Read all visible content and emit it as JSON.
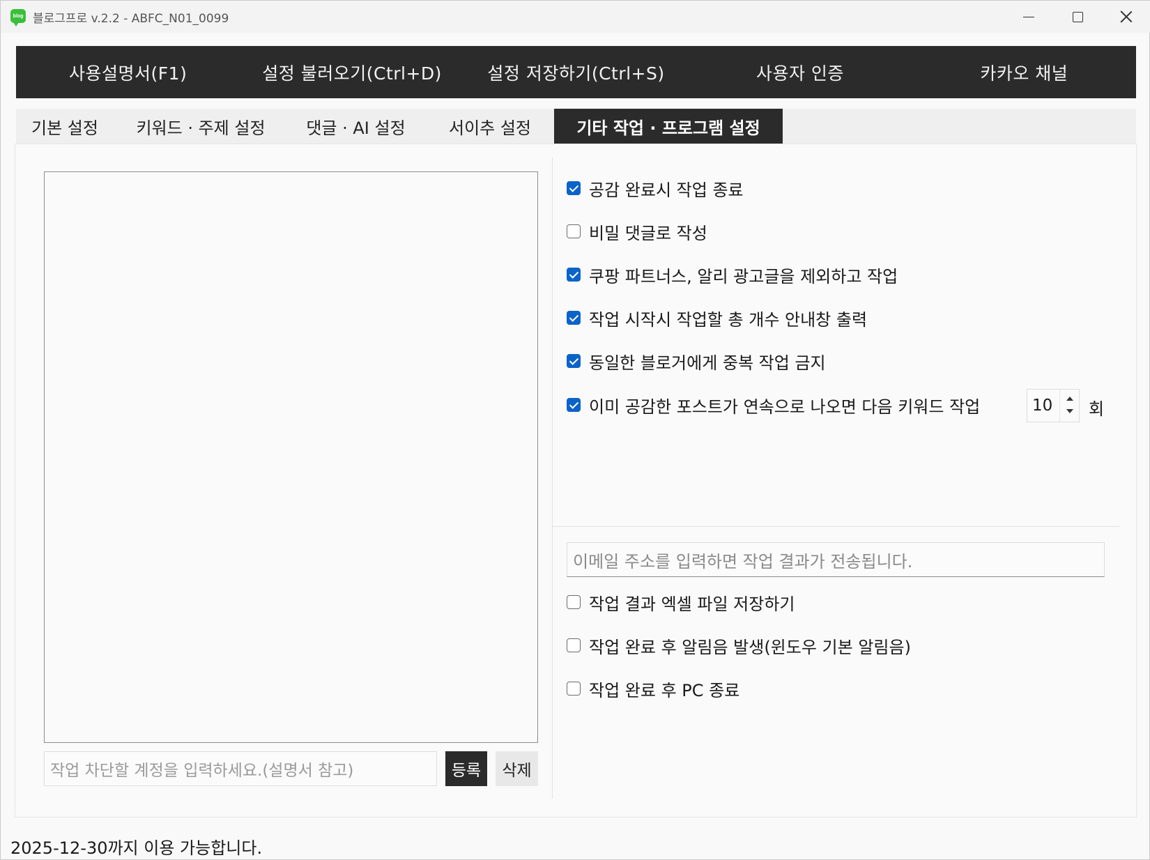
{
  "window": {
    "app_icon_text": "blog",
    "title": "블로그프로 v.2.2 - ABFC_N01_0099"
  },
  "topmenu": [
    {
      "label": "사용설명서(F1)"
    },
    {
      "label": "설정 불러오기(Ctrl+D)"
    },
    {
      "label": "설정 저장하기(Ctrl+S)"
    },
    {
      "label": "사용자 인증"
    },
    {
      "label": "카카오 채널"
    }
  ],
  "tabs": [
    {
      "label": "기본 설정",
      "active": false
    },
    {
      "label": "키워드 · 주제 설정",
      "active": false
    },
    {
      "label": "댓글 · AI 설정",
      "active": false
    },
    {
      "label": "서이추 설정",
      "active": false
    },
    {
      "label": "기타 작업 · 프로그램 설정",
      "active": true
    }
  ],
  "left": {
    "block_input_placeholder": "작업 차단할 계정을 입력하세요.(설명서 참고)",
    "register_label": "등록",
    "delete_label": "삭제"
  },
  "options": [
    {
      "label": "공감 완료시 작업 종료",
      "checked": true
    },
    {
      "label": "비밀 댓글로 작성",
      "checked": false
    },
    {
      "label": "쿠팡 파트너스, 알리 광고글을 제외하고 작업",
      "checked": true
    },
    {
      "label": "작업 시작시 작업할 총 개수 안내창 출력",
      "checked": true
    },
    {
      "label": "동일한 블로거에게 중복 작업 금지",
      "checked": true
    },
    {
      "label": "이미 공감한 포스트가 연속으로 나오면 다음 키워드 작업",
      "checked": true
    }
  ],
  "spinner": {
    "value": "10",
    "unit": "회"
  },
  "email": {
    "placeholder": "이메일 주소를 입력하면 작업 결과가 전송됩니다."
  },
  "options2": [
    {
      "label": "작업 결과 엑셀 파일 저장하기",
      "checked": false
    },
    {
      "label": "작업 완료 후 알림음 발생(윈도우 기본 알림음)",
      "checked": false
    },
    {
      "label": "작업 완료 후 PC 종료",
      "checked": false
    }
  ],
  "footer": {
    "text": "2025-12-30까지 이용 가능합니다."
  },
  "colors": {
    "accent": "#0a63c9",
    "dark": "#2b2b2b",
    "app_icon": "#3bbf3b"
  }
}
